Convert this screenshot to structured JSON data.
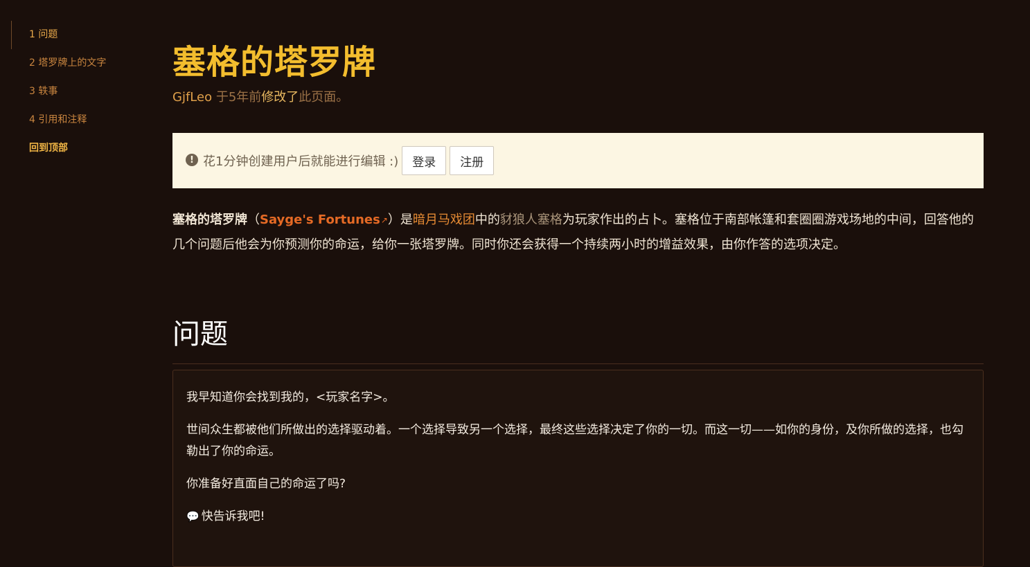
{
  "toc": {
    "items": [
      {
        "label": "1 问题"
      },
      {
        "label": "2 塔罗牌上的文字"
      },
      {
        "label": "3 轶事"
      },
      {
        "label": "4 引用和注释"
      }
    ],
    "back_to_top": "回到顶部"
  },
  "page": {
    "title": "塞格的塔罗牌",
    "meta": {
      "user": "GjfLeo",
      "time": " 于5年前",
      "action": "修改了",
      "suffix": "此页面。"
    }
  },
  "notice": {
    "icon": "exclamation-circle-icon",
    "text": "花1分钟创建用户后就能进行编辑 :)",
    "login_label": "登录",
    "register_label": "注册"
  },
  "intro": {
    "bold_title": "塞格的塔罗牌",
    "open_paren": "（",
    "ext_link": "Sayge's Fortunes",
    "ext_icon": "↗",
    "close_is": "）是",
    "link_darkmoon": "暗月马戏团",
    "mid1": "中的",
    "link_sayge": "豺狼人塞格",
    "rest": "为玩家作出的占卜。塞格位于南部帐篷和套圈圈游戏场地的中间，回答他的几个问题后他会为你预测你的命运，给你一张塔罗牌。同时你还会获得一个持续两小时的增益效果，由你作答的选项决定。"
  },
  "section": {
    "heading": "问题",
    "quote": {
      "p1": "我早知道你会找到我的，<玩家名字>。",
      "p2": "世间众生都被他们所做出的选择驱动着。一个选择导致另一个选择，最终这些选择决定了你的一切。而这一切——如你的身份，及你所做的选择，也勾勒出了你的命运。",
      "p3": "你准备好直面自己的命运了吗?",
      "p4_icon": "chat-bubble-icon",
      "p4": "快告诉我吧!"
    }
  },
  "colors": {
    "background": "#1a0f0b",
    "title": "#f3bd2e",
    "link": "#e58a33",
    "external_link": "#e56a25",
    "notice_bg": "#fcf6e3"
  }
}
